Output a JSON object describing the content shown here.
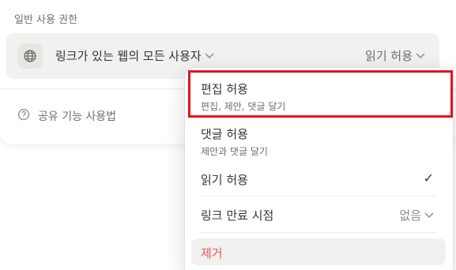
{
  "section_label": "일반 사용 권한",
  "access": {
    "scope": "링크가 있는 웹의 모든 사용자",
    "permission": "읽기 허용",
    "globe_icon": "globe-icon",
    "chevron_icon": "chevron-down-icon"
  },
  "help": {
    "label": "공유 기능 사용법",
    "icon": "question-circle-icon"
  },
  "menu": {
    "items": [
      {
        "title": "편집 허용",
        "desc": "편집, 제안, 댓글 달기",
        "selected": false
      },
      {
        "title": "댓글 허용",
        "desc": "제안과 댓글 달기",
        "selected": false
      },
      {
        "title": "읽기 허용",
        "check": "✓",
        "selected": true
      }
    ],
    "expiry": {
      "label": "링크 만료 시점",
      "value": "없음"
    },
    "remove": {
      "label": "제거"
    }
  },
  "colors": {
    "highlight": "#e3131b",
    "danger": "#eb5757",
    "row_bg": "#f1f1ef"
  }
}
